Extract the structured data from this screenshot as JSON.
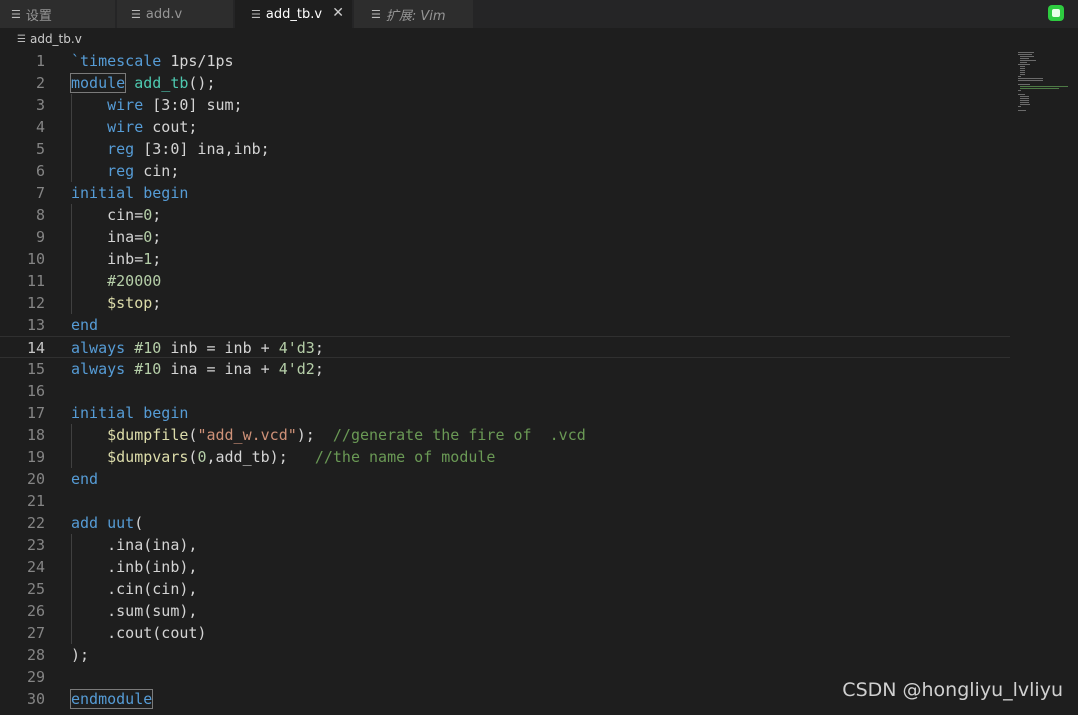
{
  "tabs": [
    {
      "label": "设置",
      "icon": "menu-lines-icon",
      "active": false,
      "italic": false
    },
    {
      "label": "add.v",
      "icon": "menu-lines-icon",
      "active": false,
      "italic": false
    },
    {
      "label": "add_tb.v",
      "icon": "menu-lines-icon",
      "active": true,
      "italic": false
    },
    {
      "label": "扩展: Vim",
      "icon": "menu-lines-icon",
      "active": false,
      "italic": true
    }
  ],
  "close_glyph": "✕",
  "breadcrumb": {
    "file": "add_tb.v"
  },
  "current_line": 14,
  "lines": [
    [
      [
        "`timescale",
        "kw"
      ],
      [
        " 1ps/1ps",
        "plain"
      ]
    ],
    [
      [
        "module",
        "kw box"
      ],
      [
        " ",
        "plain"
      ],
      [
        "add_tb",
        "id"
      ],
      [
        "();",
        "plain"
      ]
    ],
    [
      [
        "    ",
        "plain"
      ],
      [
        "wire",
        "kw"
      ],
      [
        " [3:0] sum;",
        "plain"
      ]
    ],
    [
      [
        "    ",
        "plain"
      ],
      [
        "wire",
        "kw"
      ],
      [
        " cout;",
        "plain"
      ]
    ],
    [
      [
        "    ",
        "plain"
      ],
      [
        "reg",
        "kw"
      ],
      [
        " [3:0] ina,inb;",
        "plain"
      ]
    ],
    [
      [
        "    ",
        "plain"
      ],
      [
        "reg",
        "kw"
      ],
      [
        " cin;",
        "plain"
      ]
    ],
    [
      [
        "initial",
        "kw"
      ],
      [
        " ",
        "plain"
      ],
      [
        "begin",
        "kw"
      ]
    ],
    [
      [
        "    cin=",
        "plain"
      ],
      [
        "0",
        "num"
      ],
      [
        ";",
        "plain"
      ]
    ],
    [
      [
        "    ina=",
        "plain"
      ],
      [
        "0",
        "num"
      ],
      [
        ";",
        "plain"
      ]
    ],
    [
      [
        "    inb=",
        "plain"
      ],
      [
        "1",
        "num"
      ],
      [
        ";",
        "plain"
      ]
    ],
    [
      [
        "    ",
        "plain"
      ],
      [
        "#20000",
        "num"
      ]
    ],
    [
      [
        "    ",
        "plain"
      ],
      [
        "$stop",
        "fn"
      ],
      [
        ";",
        "plain"
      ]
    ],
    [
      [
        "end",
        "kw"
      ]
    ],
    [
      [
        "always",
        "kw"
      ],
      [
        " ",
        "plain"
      ],
      [
        "#10",
        "num"
      ],
      [
        " inb = inb + ",
        "plain"
      ],
      [
        "4'd3",
        "num"
      ],
      [
        ";",
        "plain"
      ]
    ],
    [
      [
        "always",
        "kw"
      ],
      [
        " ",
        "plain"
      ],
      [
        "#10",
        "num"
      ],
      [
        " ina = ina + ",
        "plain"
      ],
      [
        "4'd2",
        "num"
      ],
      [
        ";",
        "plain"
      ]
    ],
    [],
    [
      [
        "initial",
        "kw"
      ],
      [
        " ",
        "plain"
      ],
      [
        "begin",
        "kw"
      ]
    ],
    [
      [
        "    ",
        "plain"
      ],
      [
        "$dumpfile",
        "fn"
      ],
      [
        "(",
        "plain"
      ],
      [
        "\"add_w.vcd\"",
        "str"
      ],
      [
        ");  ",
        "plain"
      ],
      [
        "//generate the fire of  .vcd",
        "com"
      ]
    ],
    [
      [
        "    ",
        "plain"
      ],
      [
        "$dumpvars",
        "fn"
      ],
      [
        "(",
        "plain"
      ],
      [
        "0",
        "num"
      ],
      [
        ",add_tb);   ",
        "plain"
      ],
      [
        "//the name of module",
        "com"
      ]
    ],
    [
      [
        "end",
        "kw"
      ]
    ],
    [],
    [
      [
        "add",
        "kw"
      ],
      [
        " ",
        "plain"
      ],
      [
        "uut",
        "kw"
      ],
      [
        "(",
        "plain"
      ]
    ],
    [
      [
        "    .ina(ina),",
        "plain"
      ]
    ],
    [
      [
        "    .inb(inb),",
        "plain"
      ]
    ],
    [
      [
        "    .cin(cin),",
        "plain"
      ]
    ],
    [
      [
        "    .sum(sum),",
        "plain"
      ]
    ],
    [
      [
        "    .cout(cout)",
        "plain"
      ]
    ],
    [
      [
        ");",
        "plain"
      ]
    ],
    [],
    [
      [
        "endmodule",
        "kw box"
      ]
    ]
  ],
  "watermark": "CSDN @hongliyu_lvliyu"
}
